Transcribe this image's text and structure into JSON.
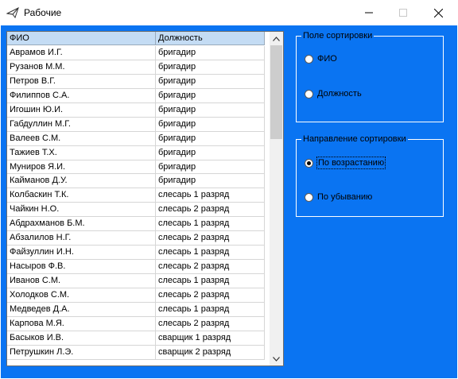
{
  "window": {
    "title": "Рабочие",
    "icon": "airplane-icon",
    "controls": [
      "minimize-icon",
      "maximize-icon",
      "close-icon"
    ]
  },
  "grid": {
    "columns": [
      "ФИО",
      "Должность"
    ],
    "rows": [
      [
        "Аврамов И.Г.",
        "бригадир"
      ],
      [
        "Рузанов М.М.",
        "бригадир"
      ],
      [
        "Петров В.Г.",
        "бригадир"
      ],
      [
        "Филиппов С.А.",
        "бригадир"
      ],
      [
        "Игошин Ю.И.",
        "бригадир"
      ],
      [
        "Габдуллин М.Г.",
        "бригадир"
      ],
      [
        "Валеев С.М.",
        "бригадир"
      ],
      [
        "Тажиев Т.Х.",
        "бригадир"
      ],
      [
        "Муниров Я.И.",
        "бригадир"
      ],
      [
        "Кайманов Д.У.",
        "бригадир"
      ],
      [
        "Колбаскин Т.К.",
        "слесарь 1 разряд"
      ],
      [
        "Чайкин Н.О.",
        "слесарь 2 разряд"
      ],
      [
        "Абдрахманов Б.М.",
        "слесарь 1 разряд"
      ],
      [
        "Абзалилов Н.Г.",
        "слесарь 2 разряд"
      ],
      [
        "Файзуллин И.Н.",
        "слесарь 1 разряд"
      ],
      [
        "Насыров Ф.В.",
        "слесарь 2 разряд"
      ],
      [
        "Иванов С.М.",
        "слесарь 1 разряд"
      ],
      [
        "Холодков С.М.",
        "слесарь 2 разряд"
      ],
      [
        "Медведев Д.А.",
        "слесарь 1 разряд"
      ],
      [
        "Карпова М.Я.",
        "слесарь 2 разряд"
      ],
      [
        "Басыков И.В.",
        "сварщик 1 разряд"
      ],
      [
        "Петрушкин Л.Э.",
        "сварщик 2 разряд"
      ]
    ]
  },
  "sort_field": {
    "legend": "Поле сортировки",
    "options": [
      "ФИО",
      "Должность"
    ],
    "selected": null
  },
  "sort_direction": {
    "legend": "Направление сортировки",
    "options": [
      "По возрастанию",
      "По убыванию"
    ],
    "selected": "По возрастанию"
  },
  "colors": {
    "client_background": "#0a74f2",
    "header_background": "#c4dcf4"
  }
}
